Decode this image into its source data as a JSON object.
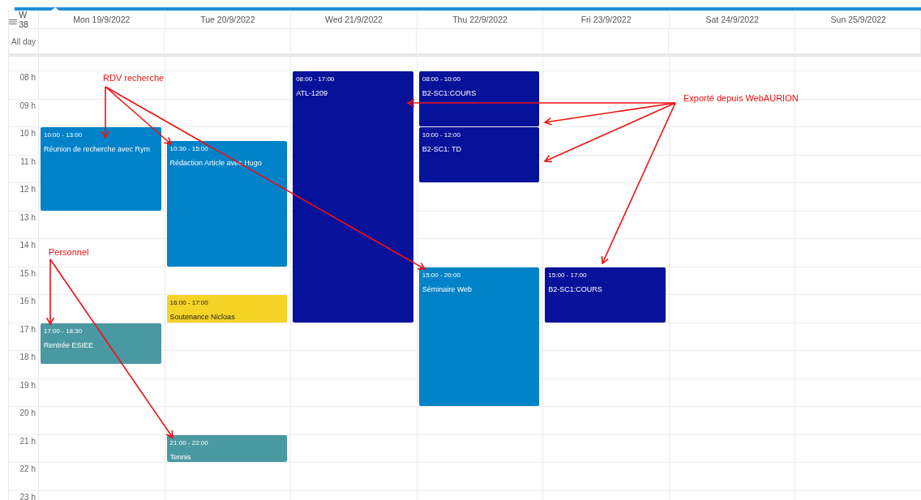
{
  "week_label": "W 38",
  "all_day_label": "All day",
  "hours": [
    "08 h",
    "09 h",
    "10 h",
    "11 h",
    "12 h",
    "13 h",
    "14 h",
    "15 h",
    "16 h",
    "17 h",
    "18 h",
    "19 h",
    "20 h",
    "21 h",
    "22 h",
    "23 h"
  ],
  "days": [
    {
      "label": "Mon 19/9/2022",
      "events": [
        {
          "time": "10:00 - 13:00",
          "title": "Réunion de recherche avec Rym",
          "color": "#0082c8"
        },
        {
          "time": "17:00 - 18:30",
          "title": "Rentrée ESIEE",
          "color": "#4a98a2"
        }
      ]
    },
    {
      "label": "Tue 20/9/2022",
      "events": [
        {
          "time": "10:30 - 15:00",
          "title": "Rédaction Article avec Hugo",
          "color": "#0082c8"
        },
        {
          "time": "16:00 - 17:00",
          "title": "Soutenance Nicloas",
          "color": "#f5d327"
        },
        {
          "time": "21:00 - 22:00",
          "title": "Tennis",
          "color": "#4a98a2"
        }
      ]
    },
    {
      "label": "Wed 21/9/2022",
      "events": [
        {
          "time": "08:00 - 17:00",
          "title": "ATL-1209",
          "color": "#07129a"
        }
      ]
    },
    {
      "label": "Thu 22/9/2022",
      "events": [
        {
          "time": "08:00 - 10:00",
          "title": "B2-SC1:COURS",
          "color": "#07129a"
        },
        {
          "time": "10:00 - 12:00",
          "title": "B2-SC1: TD",
          "color": "#07129a"
        },
        {
          "time": "15:00 - 20:00",
          "title": "Séminaire Web",
          "color": "#0082c8"
        }
      ]
    },
    {
      "label": "Fri 23/9/2022",
      "events": [
        {
          "time": "15:00 - 17:00",
          "title": "B2-SC1:COURS",
          "color": "#07129a"
        }
      ]
    },
    {
      "label": "Sat 24/9/2022"
    },
    {
      "label": "Sun 25/9/2022"
    }
  ],
  "annotations": [
    {
      "label": "RDV recherche"
    },
    {
      "label": "Personnel"
    },
    {
      "label": "Exporté depuis WebAURION"
    }
  ]
}
